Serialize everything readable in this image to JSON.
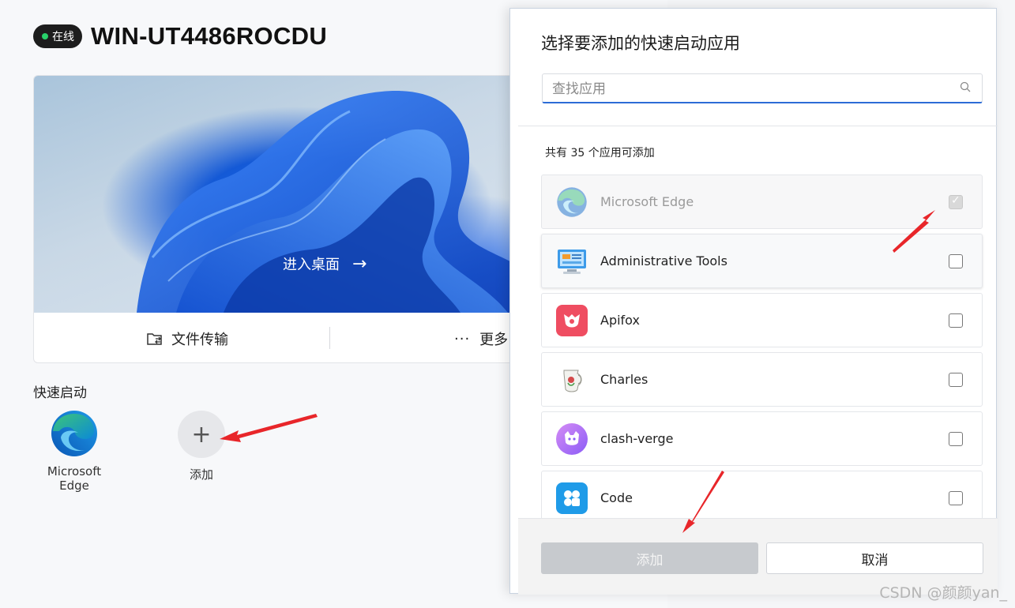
{
  "host": {
    "status_label": "在线",
    "name": "WIN-UT4486ROCDU"
  },
  "desktop_card": {
    "enter_label": "进入桌面",
    "enter_arrow": "→",
    "file_transfer_label": "文件传输",
    "more_label": "更多",
    "more_icon": "···"
  },
  "quick_launch": {
    "title": "快速启动",
    "items": [
      {
        "label": "Microsoft Edge",
        "icon": "edge-icon"
      }
    ],
    "add_label": "添加",
    "add_symbol": "+"
  },
  "dialog": {
    "title": "选择要添加的快速启动应用",
    "search_placeholder": "查找应用",
    "count_text": "共有 35 个应用可添加",
    "apps": [
      {
        "name": "Microsoft Edge",
        "icon": "edge-icon",
        "checked": true,
        "disabled": true
      },
      {
        "name": "Administrative Tools",
        "icon": "admin-tools-icon",
        "checked": false,
        "disabled": false
      },
      {
        "name": "Apifox",
        "icon": "apifox-icon",
        "checked": false,
        "disabled": false
      },
      {
        "name": "Charles",
        "icon": "charles-icon",
        "checked": false,
        "disabled": false
      },
      {
        "name": "clash-verge",
        "icon": "clash-verge-icon",
        "checked": false,
        "disabled": false
      },
      {
        "name": "Code",
        "icon": "vscode-icon",
        "checked": false,
        "disabled": false
      }
    ],
    "add_button": "添加",
    "cancel_button": "取消"
  },
  "watermark": "CSDN @颜颜yan_",
  "colors": {
    "online": "#28d16a",
    "accent": "#2c6cd6",
    "annotation": "#e8262a"
  }
}
